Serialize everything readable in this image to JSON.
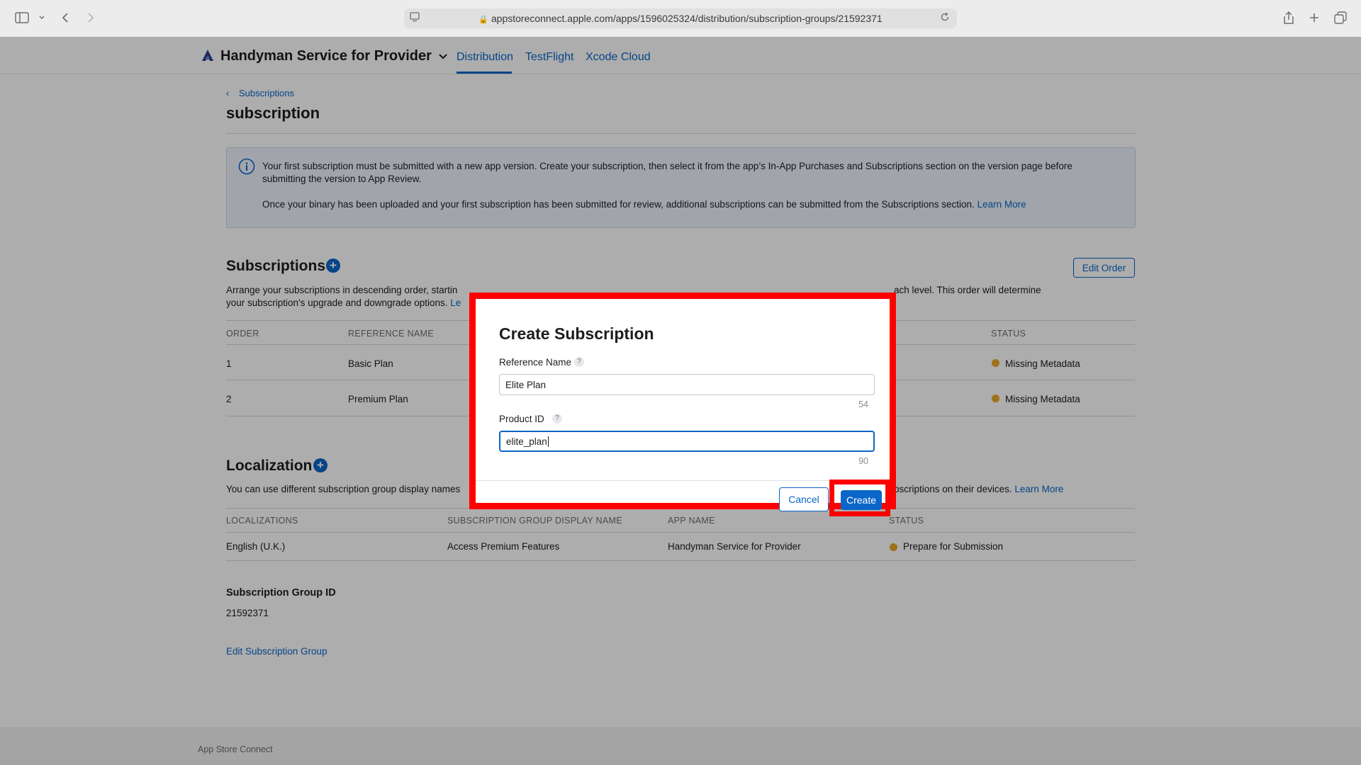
{
  "browser": {
    "url": "appstoreconnect.apple.com/apps/1596025324/distribution/subscription-groups/21592371"
  },
  "header": {
    "app_name": "Handyman Service for Provider",
    "tabs": [
      "Distribution",
      "TestFlight",
      "Xcode Cloud"
    ],
    "active_tab": "Distribution"
  },
  "page": {
    "breadcrumb": "Subscriptions",
    "title": "subscription",
    "info_line1": "Your first subscription must be submitted with a new app version. Create your subscription, then select it from the app’s In-App Purchases and Subscriptions section on the version page before",
    "info_line2": "submitting the version to App Review.",
    "info_line3": "Once your binary has been uploaded and your first subscription has been submitted for review, additional subscriptions can be submitted from the Subscriptions section.",
    "info_learn_more": "Learn More"
  },
  "subscriptions": {
    "title": "Subscriptions",
    "edit_order": "Edit Order",
    "desc_left": "Arrange your subscriptions in descending order, startin",
    "desc_right": "ach level. This order will determine",
    "desc_line2": "your subscription's upgrade and downgrade options.",
    "desc_line2_link": "Le",
    "columns": [
      "ORDER",
      "REFERENCE NAME",
      "STATUS"
    ],
    "rows": [
      {
        "order": "1",
        "name": "Basic Plan",
        "status": "Missing Metadata"
      },
      {
        "order": "2",
        "name": "Premium Plan",
        "status": "Missing Metadata"
      }
    ]
  },
  "localization": {
    "title": "Localization",
    "desc_left": "You can use different subscription group display names",
    "desc_right": "bscriptions on their devices.",
    "learn_more": "Learn More",
    "columns": [
      "LOCALIZATIONS",
      "SUBSCRIPTION GROUP DISPLAY NAME",
      "APP NAME",
      "STATUS"
    ],
    "rows": [
      {
        "locale": "English (U.K.)",
        "display_name": "Access Premium Features",
        "app_name": "Handyman Service for Provider",
        "status": "Prepare for Submission"
      }
    ]
  },
  "group": {
    "id_label": "Subscription Group ID",
    "id_value": "21592371",
    "edit_link": "Edit Subscription Group"
  },
  "modal": {
    "title": "Create Subscription",
    "reference_label": "Reference Name",
    "reference_value": "Elite Plan",
    "reference_counter": "54",
    "product_label": "Product ID",
    "product_value": "elite_plan",
    "product_counter": "90",
    "help_glyph": "?",
    "cancel": "Cancel",
    "create": "Create"
  },
  "footer": {
    "text": "App Store Connect"
  },
  "colors": {
    "accent": "#0a66c8",
    "highlight": "#ff0000",
    "status_dot": "#e7a824"
  }
}
